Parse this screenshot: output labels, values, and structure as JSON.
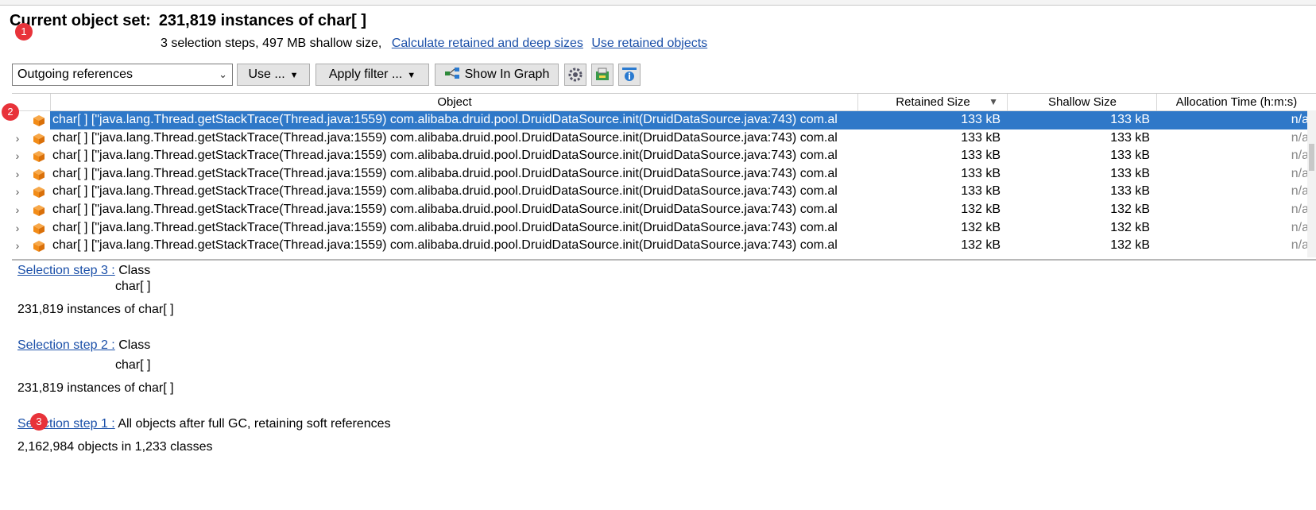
{
  "header": {
    "title_label": "Current object set:",
    "title_value": "231,819 instances of char[ ]",
    "summary": "3 selection steps, 497 MB shallow size,",
    "link_retained": "Calculate retained and deep sizes",
    "link_use_retained": "Use retained objects"
  },
  "toolbar": {
    "view_select": "Outgoing references",
    "use_button": "Use ...",
    "filter_button": "Apply filter ...",
    "graph_button": "Show In Graph",
    "icons": [
      "settings-icon",
      "export-icon",
      "info-panel-icon"
    ]
  },
  "table": {
    "columns": [
      "Object",
      "Retained Size",
      "Shallow Size",
      "Allocation Time (h:m:s)"
    ],
    "rows": [
      {
        "object": "char[ ] [\"java.lang.Thread.getStackTrace(Thread.java:1559) com.alibaba.druid.pool.DruidDataSource.init(DruidDataSource.java:743) com.al",
        "retained": "133 kB",
        "shallow": "133 kB",
        "alloc": "n/a"
      },
      {
        "object": "char[ ] [\"java.lang.Thread.getStackTrace(Thread.java:1559) com.alibaba.druid.pool.DruidDataSource.init(DruidDataSource.java:743) com.al",
        "retained": "133 kB",
        "shallow": "133 kB",
        "alloc": "n/a"
      },
      {
        "object": "char[ ] [\"java.lang.Thread.getStackTrace(Thread.java:1559) com.alibaba.druid.pool.DruidDataSource.init(DruidDataSource.java:743) com.al",
        "retained": "133 kB",
        "shallow": "133 kB",
        "alloc": "n/a"
      },
      {
        "object": "char[ ] [\"java.lang.Thread.getStackTrace(Thread.java:1559) com.alibaba.druid.pool.DruidDataSource.init(DruidDataSource.java:743) com.al",
        "retained": "133 kB",
        "shallow": "133 kB",
        "alloc": "n/a"
      },
      {
        "object": "char[ ] [\"java.lang.Thread.getStackTrace(Thread.java:1559) com.alibaba.druid.pool.DruidDataSource.init(DruidDataSource.java:743) com.al",
        "retained": "133 kB",
        "shallow": "133 kB",
        "alloc": "n/a"
      },
      {
        "object": "char[ ] [\"java.lang.Thread.getStackTrace(Thread.java:1559) com.alibaba.druid.pool.DruidDataSource.init(DruidDataSource.java:743) com.al",
        "retained": "132 kB",
        "shallow": "132 kB",
        "alloc": "n/a"
      },
      {
        "object": "char[ ] [\"java.lang.Thread.getStackTrace(Thread.java:1559) com.alibaba.druid.pool.DruidDataSource.init(DruidDataSource.java:743) com.al",
        "retained": "132 kB",
        "shallow": "132 kB",
        "alloc": "n/a"
      },
      {
        "object": "char[ ] [\"java.lang.Thread.getStackTrace(Thread.java:1559) com.alibaba.druid.pool.DruidDataSource.init(DruidDataSource.java:743) com.al",
        "retained": "132 kB",
        "shallow": "132 kB",
        "alloc": "n/a"
      }
    ]
  },
  "steps": [
    {
      "link": "Selection step 3 :",
      "kind": "Class",
      "detail": "char[ ]",
      "result": "231,819 instances of char[ ]"
    },
    {
      "link": "Selection step 2 :",
      "kind": "Class",
      "detail": "char[ ]",
      "result": "231,819 instances of char[ ]"
    },
    {
      "link": "Selection step 1 :",
      "kind": "All objects after full GC, retaining soft references",
      "result": "2,162,984 objects in 1,233 classes"
    }
  ],
  "markers": [
    "1",
    "2",
    "3"
  ],
  "colors": {
    "selection": "#2f78c8",
    "link": "#1a4fa8",
    "marker": "#e8333a",
    "cube": "#f28c18"
  }
}
